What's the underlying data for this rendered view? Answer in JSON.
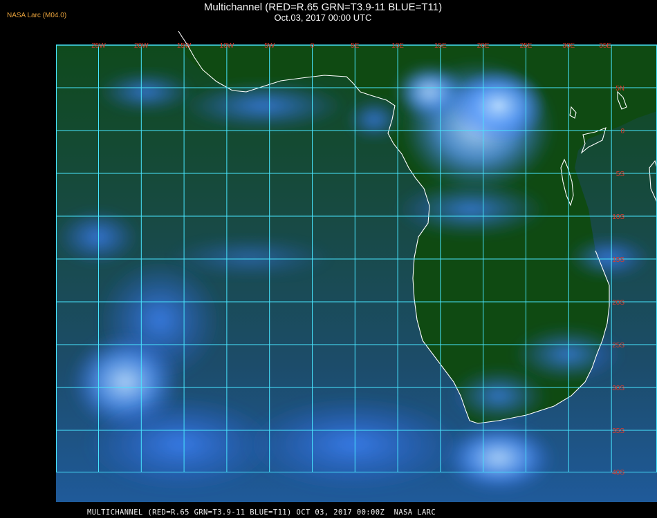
{
  "header": {
    "credit": "NASA Larc (M04.0)",
    "title": "Multichannel (RED=R.65 GRN=T3.9-11 BLUE=T11)",
    "subtitle": "Oct.03, 2017 00:00 UTC"
  },
  "footer": {
    "caption": "MULTICHANNEL (RED=R.65 GRN=T3.9-11 BLUE=T11) OCT 03, 2017 00:00Z  NASA LARC"
  },
  "map": {
    "longitude_labels": [
      "25W",
      "20W",
      "15W",
      "10W",
      "5W",
      "0",
      "5E",
      "10E",
      "15E",
      "20E",
      "25E",
      "30E",
      "35E"
    ],
    "latitude_labels": [
      "5N",
      "0",
      "5S",
      "10S",
      "15S",
      "20S",
      "25S",
      "30S",
      "35S",
      "40S"
    ],
    "colors": {
      "grid": "#48e6ff",
      "coastline": "#ffffff",
      "labels": "#e03a2a",
      "ocean": "#16504a",
      "land": "#0f4a12",
      "cloud": "#3f88ff",
      "bright_cloud": "#bfe4ff"
    }
  }
}
